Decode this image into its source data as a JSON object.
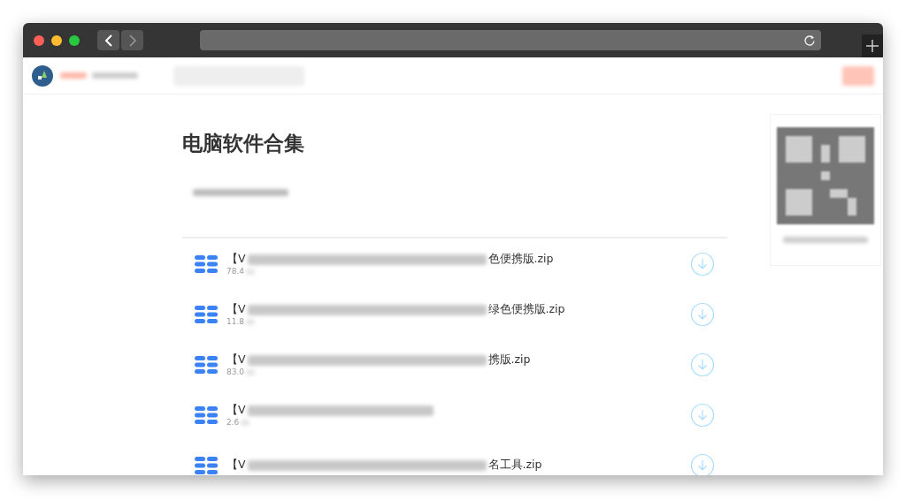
{
  "page": {
    "title": "电脑软件合集"
  },
  "files": [
    {
      "name_start": "【V",
      "name_end": "色便携版.zip",
      "size": "78.4"
    },
    {
      "name_start": "【V",
      "name_end": "绿色便携版.zip",
      "size": "11.8"
    },
    {
      "name_start": "【V",
      "name_end": "携版.zip",
      "size": "83.0"
    },
    {
      "name_start": "【V",
      "size": "2.6"
    },
    {
      "name_start": "【V",
      "name_end": "名工具.zip"
    }
  ]
}
